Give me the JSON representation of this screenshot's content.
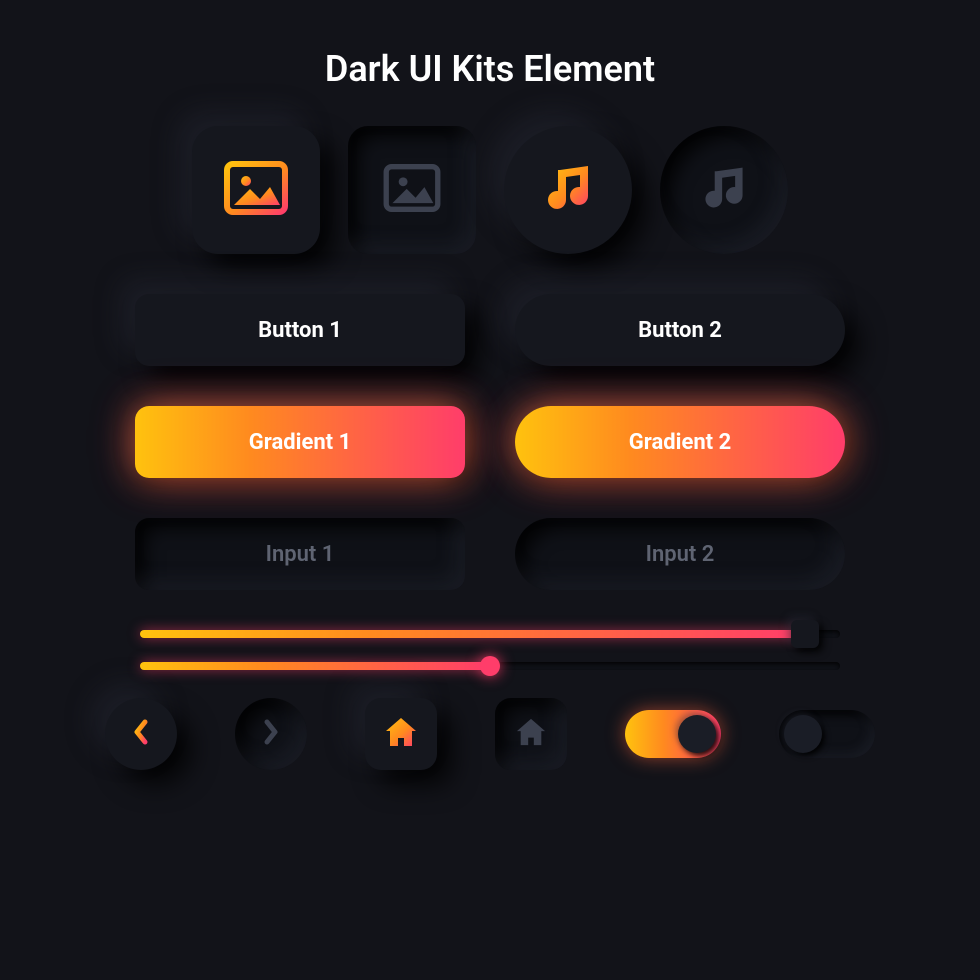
{
  "title": "Dark UI Kits Element",
  "colors": {
    "background": "#121319",
    "surface": "#15171e",
    "inset": "#0f1117",
    "muted": "#5f6472",
    "icon_dark": "#3c414f",
    "gradient": [
      "#ffc20e",
      "#ff8a1f",
      "#ff3d6a"
    ]
  },
  "tiles": [
    {
      "icon": "image-icon",
      "shape": "square",
      "style": "raised",
      "active": true
    },
    {
      "icon": "image-icon",
      "shape": "square",
      "style": "inset",
      "active": false
    },
    {
      "icon": "music-icon",
      "shape": "circle",
      "style": "raised",
      "active": true
    },
    {
      "icon": "music-icon",
      "shape": "circle",
      "style": "inset",
      "active": false
    }
  ],
  "buttons": {
    "plain": [
      {
        "label": "Button 1",
        "shape": "rect"
      },
      {
        "label": "Button 2",
        "shape": "pill"
      }
    ],
    "gradient": [
      {
        "label": "Gradient 1",
        "shape": "rect"
      },
      {
        "label": "Gradient 2",
        "shape": "pill"
      }
    ]
  },
  "inputs": [
    {
      "placeholder": "Input 1",
      "shape": "rect"
    },
    {
      "placeholder": "Input 2",
      "shape": "pill"
    }
  ],
  "sliders": [
    {
      "value": 95,
      "min": 0,
      "max": 100,
      "thumb": "square"
    },
    {
      "value": 50,
      "min": 0,
      "max": 100,
      "thumb": "circle"
    }
  ],
  "nav": [
    {
      "icon": "chevron-left-icon",
      "shape": "circle",
      "active": true
    },
    {
      "icon": "chevron-right-icon",
      "shape": "circle",
      "active": false
    },
    {
      "icon": "home-icon",
      "shape": "square",
      "active": true
    },
    {
      "icon": "home-icon",
      "shape": "square",
      "active": false
    }
  ],
  "toggles": [
    {
      "state": "on"
    },
    {
      "state": "off"
    }
  ]
}
